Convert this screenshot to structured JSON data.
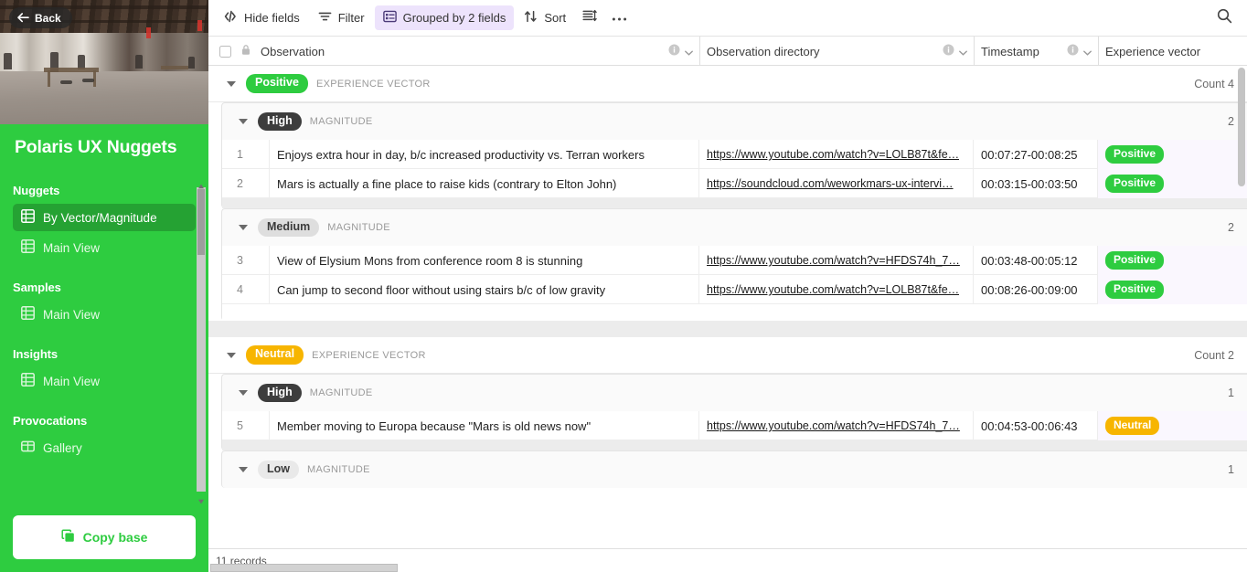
{
  "sidebar": {
    "back_label": "Back",
    "base_title": "Polaris UX Nuggets",
    "groups": [
      {
        "title": "Nuggets",
        "items": [
          {
            "label": "By Vector/Magnitude",
            "icon": "grid-table-icon",
            "active": true
          },
          {
            "label": "Main View",
            "icon": "grid-table-icon",
            "active": false
          }
        ]
      },
      {
        "title": "Samples",
        "items": [
          {
            "label": "Main View",
            "icon": "grid-table-icon",
            "active": false
          }
        ]
      },
      {
        "title": "Insights",
        "items": [
          {
            "label": "Main View",
            "icon": "grid-table-icon",
            "active": false
          }
        ]
      },
      {
        "title": "Provocations",
        "items": [
          {
            "label": "Gallery",
            "icon": "gallery-icon",
            "active": false
          }
        ]
      }
    ],
    "copy_base_label": "Copy base",
    "accent_color": "#2ecc40",
    "active_item_color": "#25a233"
  },
  "toolbar": {
    "hide_fields_label": "Hide fields",
    "filter_label": "Filter",
    "group_label": "Grouped by 2 fields",
    "sort_label": "Sort",
    "row_height_icon": "row-height-icon",
    "more_icon": "ellipsis-icon",
    "search_icon": "search-icon",
    "active_bg": "#ede3fc"
  },
  "grid": {
    "columns": [
      {
        "name": "Observation",
        "icon": "lock-icon",
        "has_info": true,
        "has_dropdown": true
      },
      {
        "name": "Observation directory",
        "has_info": true,
        "has_dropdown": true
      },
      {
        "name": "Timestamp",
        "has_info": true,
        "has_dropdown": true
      },
      {
        "name": "Experience vector",
        "has_info": true,
        "has_dropdown": false
      }
    ],
    "groups": [
      {
        "value": "Positive",
        "field": "EXPERIENCE VECTOR",
        "chip_color": "#2ecc40",
        "chip_style": "color",
        "count_label": "Count 4",
        "subgroups": [
          {
            "value": "High",
            "field": "MAGNITUDE",
            "chip_style": "dark",
            "count": "2",
            "rows": [
              {
                "num": "1",
                "observation": "Enjoys extra hour in day, b/c increased productivity vs. Terran workers",
                "directory": "https://www.youtube.com/watch?v=LOLB87t&fe…",
                "timestamp": "00:07:27-00:08:25",
                "vector": "Positive",
                "vector_color": "#2ecc40"
              },
              {
                "num": "2",
                "observation": "Mars is actually a fine place to raise kids (contrary to Elton John)",
                "directory": "https://soundcloud.com/weworkmars-ux-intervi…",
                "timestamp": "00:03:15-00:03:50",
                "vector": "Positive",
                "vector_color": "#2ecc40"
              }
            ]
          },
          {
            "value": "Medium",
            "field": "MAGNITUDE",
            "chip_style": "grey",
            "count": "2",
            "rows": [
              {
                "num": "3",
                "observation": "View of Elysium Mons from conference room 8 is stunning",
                "directory": "https://www.youtube.com/watch?v=HFDS74h_7…",
                "timestamp": "00:03:48-00:05:12",
                "vector": "Positive",
                "vector_color": "#2ecc40"
              },
              {
                "num": "4",
                "observation": "Can jump to second floor without using stairs b/c of low gravity",
                "directory": "https://www.youtube.com/watch?v=LOLB87t&fe…",
                "timestamp": "00:08:26-00:09:00",
                "vector": "Positive",
                "vector_color": "#2ecc40"
              }
            ]
          }
        ]
      },
      {
        "value": "Neutral",
        "field": "EXPERIENCE VECTOR",
        "chip_color": "#f7b500",
        "chip_style": "color",
        "count_label": "Count 2",
        "subgroups": [
          {
            "value": "High",
            "field": "MAGNITUDE",
            "chip_style": "dark",
            "count": "1",
            "rows": [
              {
                "num": "5",
                "observation": "Member moving to Europa because \"Mars is old news now\"",
                "directory": "https://www.youtube.com/watch?v=HFDS74h_7…",
                "timestamp": "00:04:53-00:06:43",
                "vector": "Neutral",
                "vector_color": "#f7b500"
              }
            ]
          },
          {
            "value": "Low",
            "field": "MAGNITUDE",
            "chip_style": "lgrey",
            "count": "1",
            "rows": []
          }
        ]
      }
    ],
    "record_count_label": "11 records"
  }
}
